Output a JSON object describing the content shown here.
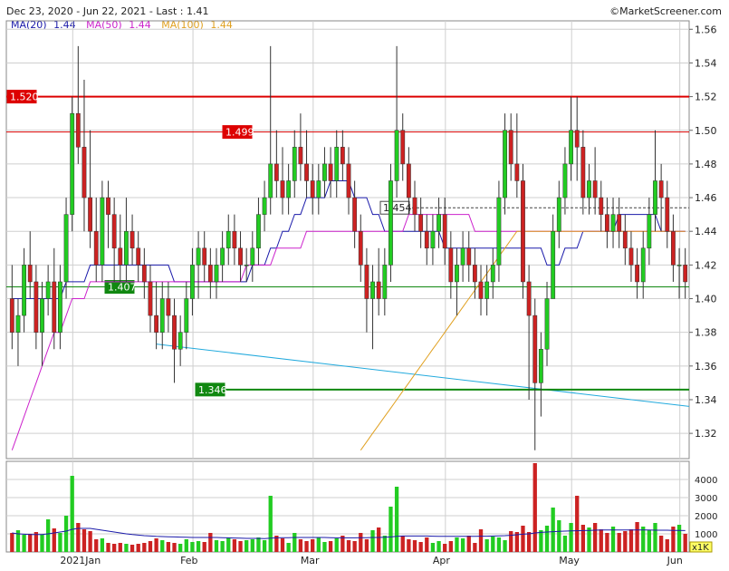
{
  "header": {
    "title": "Dec 23, 2020 - Jun 22, 2021 - Last : 1.41",
    "copyright": "©MarketScreener.com"
  },
  "legend": [
    {
      "label": "MA(20)",
      "value": "1.44",
      "color": "#1a1aaa"
    },
    {
      "label": "MA(50)",
      "value": "1.44",
      "color": "#cc22cc"
    },
    {
      "label": "MA(100)",
      "value": "1.44",
      "color": "#e0a020"
    }
  ],
  "colors": {
    "up": "#22cc22",
    "down": "#cc2222",
    "ma20": "#1a1aaa",
    "ma50": "#cc22cc",
    "ma100": "#e0a020",
    "trend": "#22aadd",
    "grid": "#cfcfcf"
  },
  "chart_data": [
    {
      "type": "candlestick",
      "y_axis_ticks": [
        "1.56",
        "1.54",
        "1.52",
        "1.50",
        "1.48",
        "1.46",
        "1.44",
        "1.42",
        "1.40",
        "1.38",
        "1.36",
        "1.34",
        "1.32"
      ],
      "ylim": [
        1.305,
        1.565
      ],
      "x_axis_labels": [
        "2021Jan",
        "Feb",
        "Mar",
        "Apr",
        "May",
        "Jun"
      ],
      "levels": [
        {
          "label": "1.520",
          "value": 1.52,
          "color": "#dd0000",
          "style": "solid-thick"
        },
        {
          "label": "1.499",
          "value": 1.499,
          "color": "#dd0000",
          "style": "solid"
        },
        {
          "label": "1.454",
          "value": 1.454,
          "color": "#444444",
          "style": "dashed"
        },
        {
          "label": "1.407",
          "value": 1.407,
          "color": "#118811",
          "style": "solid"
        },
        {
          "label": "1.346",
          "value": 1.346,
          "color": "#118811",
          "style": "solid-thick"
        }
      ],
      "trendline": {
        "from": [
          24,
          1.373
        ],
        "to": [
          124,
          1.336
        ]
      },
      "candles": [
        [
          1.4,
          1.42,
          1.37,
          1.38
        ],
        [
          1.38,
          1.4,
          1.36,
          1.39
        ],
        [
          1.39,
          1.43,
          1.38,
          1.42
        ],
        [
          1.42,
          1.44,
          1.4,
          1.41
        ],
        [
          1.41,
          1.42,
          1.37,
          1.38
        ],
        [
          1.38,
          1.41,
          1.36,
          1.4
        ],
        [
          1.4,
          1.42,
          1.39,
          1.41
        ],
        [
          1.41,
          1.43,
          1.37,
          1.38
        ],
        [
          1.38,
          1.42,
          1.37,
          1.41
        ],
        [
          1.41,
          1.46,
          1.4,
          1.45
        ],
        [
          1.45,
          1.52,
          1.44,
          1.51
        ],
        [
          1.51,
          1.55,
          1.48,
          1.49
        ],
        [
          1.49,
          1.53,
          1.44,
          1.46
        ],
        [
          1.46,
          1.5,
          1.43,
          1.44
        ],
        [
          1.44,
          1.46,
          1.41,
          1.42
        ],
        [
          1.42,
          1.47,
          1.41,
          1.46
        ],
        [
          1.46,
          1.47,
          1.43,
          1.45
        ],
        [
          1.45,
          1.46,
          1.41,
          1.43
        ],
        [
          1.43,
          1.45,
          1.41,
          1.42
        ],
        [
          1.42,
          1.46,
          1.41,
          1.44
        ],
        [
          1.44,
          1.45,
          1.42,
          1.43
        ],
        [
          1.43,
          1.44,
          1.41,
          1.42
        ],
        [
          1.42,
          1.43,
          1.4,
          1.41
        ],
        [
          1.41,
          1.42,
          1.38,
          1.39
        ],
        [
          1.39,
          1.41,
          1.37,
          1.38
        ],
        [
          1.38,
          1.41,
          1.37,
          1.4
        ],
        [
          1.4,
          1.41,
          1.38,
          1.39
        ],
        [
          1.39,
          1.4,
          1.35,
          1.37
        ],
        [
          1.37,
          1.39,
          1.36,
          1.38
        ],
        [
          1.38,
          1.41,
          1.37,
          1.4
        ],
        [
          1.4,
          1.43,
          1.39,
          1.42
        ],
        [
          1.42,
          1.44,
          1.4,
          1.43
        ],
        [
          1.43,
          1.44,
          1.41,
          1.42
        ],
        [
          1.42,
          1.43,
          1.4,
          1.41
        ],
        [
          1.41,
          1.43,
          1.4,
          1.42
        ],
        [
          1.42,
          1.44,
          1.41,
          1.43
        ],
        [
          1.43,
          1.45,
          1.42,
          1.44
        ],
        [
          1.44,
          1.45,
          1.42,
          1.43
        ],
        [
          1.43,
          1.44,
          1.41,
          1.42
        ],
        [
          1.42,
          1.43,
          1.41,
          1.42
        ],
        [
          1.42,
          1.44,
          1.41,
          1.43
        ],
        [
          1.43,
          1.46,
          1.42,
          1.45
        ],
        [
          1.45,
          1.47,
          1.44,
          1.46
        ],
        [
          1.46,
          1.55,
          1.45,
          1.48
        ],
        [
          1.48,
          1.5,
          1.46,
          1.47
        ],
        [
          1.47,
          1.49,
          1.45,
          1.46
        ],
        [
          1.46,
          1.48,
          1.45,
          1.47
        ],
        [
          1.47,
          1.5,
          1.46,
          1.49
        ],
        [
          1.49,
          1.51,
          1.47,
          1.48
        ],
        [
          1.48,
          1.5,
          1.46,
          1.47
        ],
        [
          1.47,
          1.48,
          1.45,
          1.46
        ],
        [
          1.46,
          1.48,
          1.45,
          1.47
        ],
        [
          1.47,
          1.49,
          1.46,
          1.48
        ],
        [
          1.48,
          1.49,
          1.46,
          1.47
        ],
        [
          1.47,
          1.5,
          1.46,
          1.49
        ],
        [
          1.49,
          1.5,
          1.47,
          1.48
        ],
        [
          1.48,
          1.49,
          1.45,
          1.46
        ],
        [
          1.46,
          1.47,
          1.43,
          1.44
        ],
        [
          1.44,
          1.45,
          1.41,
          1.42
        ],
        [
          1.42,
          1.43,
          1.38,
          1.4
        ],
        [
          1.4,
          1.42,
          1.37,
          1.41
        ],
        [
          1.41,
          1.43,
          1.39,
          1.4
        ],
        [
          1.4,
          1.43,
          1.39,
          1.42
        ],
        [
          1.42,
          1.48,
          1.41,
          1.47
        ],
        [
          1.47,
          1.55,
          1.46,
          1.5
        ],
        [
          1.5,
          1.51,
          1.47,
          1.48
        ],
        [
          1.48,
          1.49,
          1.45,
          1.46
        ],
        [
          1.46,
          1.47,
          1.44,
          1.45
        ],
        [
          1.45,
          1.46,
          1.43,
          1.44
        ],
        [
          1.44,
          1.45,
          1.42,
          1.43
        ],
        [
          1.43,
          1.45,
          1.42,
          1.44
        ],
        [
          1.44,
          1.46,
          1.43,
          1.45
        ],
        [
          1.45,
          1.46,
          1.42,
          1.43
        ],
        [
          1.43,
          1.44,
          1.4,
          1.41
        ],
        [
          1.41,
          1.43,
          1.39,
          1.42
        ],
        [
          1.42,
          1.44,
          1.41,
          1.43
        ],
        [
          1.43,
          1.44,
          1.41,
          1.42
        ],
        [
          1.42,
          1.43,
          1.4,
          1.41
        ],
        [
          1.41,
          1.42,
          1.39,
          1.4
        ],
        [
          1.4,
          1.42,
          1.39,
          1.41
        ],
        [
          1.41,
          1.43,
          1.4,
          1.42
        ],
        [
          1.42,
          1.47,
          1.41,
          1.46
        ],
        [
          1.46,
          1.51,
          1.45,
          1.5
        ],
        [
          1.5,
          1.51,
          1.47,
          1.48
        ],
        [
          1.48,
          1.51,
          1.46,
          1.47
        ],
        [
          1.47,
          1.48,
          1.4,
          1.41
        ],
        [
          1.41,
          1.42,
          1.34,
          1.39
        ],
        [
          1.39,
          1.4,
          1.31,
          1.35
        ],
        [
          1.35,
          1.38,
          1.33,
          1.37
        ],
        [
          1.37,
          1.41,
          1.36,
          1.4
        ],
        [
          1.4,
          1.45,
          1.4,
          1.44
        ],
        [
          1.44,
          1.47,
          1.43,
          1.46
        ],
        [
          1.46,
          1.49,
          1.45,
          1.48
        ],
        [
          1.48,
          1.52,
          1.47,
          1.5
        ],
        [
          1.5,
          1.52,
          1.47,
          1.49
        ],
        [
          1.49,
          1.5,
          1.45,
          1.46
        ],
        [
          1.46,
          1.48,
          1.45,
          1.47
        ],
        [
          1.47,
          1.49,
          1.45,
          1.46
        ],
        [
          1.46,
          1.47,
          1.44,
          1.45
        ],
        [
          1.45,
          1.46,
          1.43,
          1.44
        ],
        [
          1.44,
          1.46,
          1.43,
          1.45
        ],
        [
          1.45,
          1.46,
          1.43,
          1.44
        ],
        [
          1.44,
          1.45,
          1.42,
          1.43
        ],
        [
          1.43,
          1.44,
          1.41,
          1.42
        ],
        [
          1.42,
          1.43,
          1.4,
          1.41
        ],
        [
          1.41,
          1.44,
          1.4,
          1.43
        ],
        [
          1.43,
          1.46,
          1.42,
          1.45
        ],
        [
          1.45,
          1.5,
          1.44,
          1.47
        ],
        [
          1.47,
          1.48,
          1.44,
          1.46
        ],
        [
          1.46,
          1.47,
          1.43,
          1.44
        ],
        [
          1.44,
          1.45,
          1.41,
          1.42
        ],
        [
          1.42,
          1.43,
          1.4,
          1.42
        ],
        [
          1.42,
          1.43,
          1.4,
          1.41
        ]
      ],
      "ma20": [
        1.4,
        1.4,
        1.4,
        1.4,
        1.4,
        1.4,
        1.4,
        1.4,
        1.4,
        1.41,
        1.41,
        1.41,
        1.41,
        1.42,
        1.42,
        1.42,
        1.42,
        1.42,
        1.42,
        1.42,
        1.42,
        1.42,
        1.42,
        1.42,
        1.42,
        1.42,
        1.42,
        1.41,
        1.41,
        1.41,
        1.41,
        1.41,
        1.41,
        1.41,
        1.41,
        1.41,
        1.41,
        1.41,
        1.41,
        1.41,
        1.42,
        1.42,
        1.42,
        1.43,
        1.43,
        1.44,
        1.44,
        1.45,
        1.45,
        1.46,
        1.46,
        1.46,
        1.46,
        1.47,
        1.47,
        1.47,
        1.47,
        1.46,
        1.46,
        1.46,
        1.45,
        1.45,
        1.44,
        1.44,
        1.44,
        1.44,
        1.44,
        1.44,
        1.44,
        1.44,
        1.44,
        1.44,
        1.43,
        1.43,
        1.43,
        1.43,
        1.43,
        1.43,
        1.43,
        1.43,
        1.43,
        1.43,
        1.43,
        1.43,
        1.43,
        1.43,
        1.43,
        1.43,
        1.43,
        1.42,
        1.42,
        1.42,
        1.43,
        1.43,
        1.43,
        1.44,
        1.44,
        1.44,
        1.44,
        1.44,
        1.44,
        1.45,
        1.45,
        1.45,
        1.45,
        1.45,
        1.45,
        1.45,
        1.44,
        1.44,
        1.44,
        1.44,
        1.44
      ],
      "ma50": [
        1.31,
        1.32,
        1.33,
        1.34,
        1.35,
        1.36,
        1.37,
        1.38,
        1.38,
        1.39,
        1.4,
        1.4,
        1.4,
        1.41,
        1.41,
        1.41,
        1.41,
        1.41,
        1.41,
        1.41,
        1.41,
        1.41,
        1.41,
        1.41,
        1.41,
        1.41,
        1.41,
        1.41,
        1.41,
        1.41,
        1.41,
        1.41,
        1.41,
        1.41,
        1.41,
        1.41,
        1.41,
        1.41,
        1.41,
        1.42,
        1.42,
        1.42,
        1.42,
        1.42,
        1.43,
        1.43,
        1.43,
        1.43,
        1.43,
        1.44,
        1.44,
        1.44,
        1.44,
        1.44,
        1.44,
        1.44,
        1.44,
        1.44,
        1.44,
        1.44,
        1.44,
        1.44,
        1.44,
        1.44,
        1.44,
        1.44,
        1.45,
        1.45,
        1.45,
        1.45,
        1.45,
        1.45,
        1.45,
        1.45,
        1.45,
        1.45,
        1.45,
        1.44,
        1.44,
        1.44,
        1.44,
        1.44,
        1.44,
        1.44,
        1.44,
        1.44,
        1.44,
        1.44,
        1.44,
        1.44,
        1.44,
        1.44,
        1.44,
        1.44,
        1.44,
        1.44,
        1.44,
        1.44,
        1.44,
        1.44,
        1.44,
        1.44,
        1.44,
        1.44,
        1.44,
        1.44,
        1.44,
        1.44,
        1.44,
        1.44,
        1.44,
        1.44,
        1.44
      ],
      "ma100": [
        1.31,
        1.315,
        1.32,
        1.325,
        1.33,
        1.335,
        1.34,
        1.345,
        1.35,
        1.355,
        1.36,
        1.365,
        1.37,
        1.375,
        1.38,
        1.385,
        1.39,
        1.395,
        1.4,
        1.405,
        1.41,
        1.415,
        1.42,
        1.425,
        1.43,
        1.435,
        1.44,
        1.44,
        1.44,
        1.44,
        1.44,
        1.44,
        1.44,
        1.44,
        1.44,
        1.44,
        1.44,
        1.44,
        1.44,
        1.44,
        1.44,
        1.44,
        1.44,
        1.44,
        1.44,
        1.44,
        1.44,
        1.44,
        1.44,
        1.44,
        1.44,
        1.44,
        1.44,
        1.44,
        1.44,
        1.44,
        1.44,
        1.44,
        1.44,
        1.44,
        1.44,
        1.44,
        1.44,
        1.44,
        1.44,
        1.44,
        1.44,
        1.44,
        1.44,
        1.44,
        1.44,
        1.44,
        1.44,
        1.44,
        1.44,
        1.44,
        1.44,
        1.44,
        1.44,
        1.44,
        1.44,
        1.44,
        1.44,
        1.44,
        1.44,
        1.44,
        1.44,
        1.44,
        1.44,
        1.44,
        1.44,
        1.44,
        1.44,
        1.44,
        1.44,
        1.44,
        1.44,
        1.44,
        1.44,
        1.44,
        1.44,
        1.44,
        1.44,
        1.44,
        1.44,
        1.44,
        1.44,
        1.44,
        1.44,
        1.44,
        1.44,
        1.44,
        1.44
      ],
      "ma100_start_index": 58
    },
    {
      "type": "bar",
      "title": "",
      "y_axis_ticks": [
        "4000",
        "3000",
        "2000",
        "1000"
      ],
      "ylim": [
        0,
        4900
      ],
      "unit": "x1K",
      "volumes": [
        1050,
        1200,
        950,
        1000,
        1100,
        950,
        1800,
        1300,
        1050,
        2000,
        4200,
        1600,
        1250,
        1150,
        700,
        750,
        500,
        450,
        500,
        450,
        400,
        450,
        500,
        600,
        750,
        650,
        550,
        500,
        450,
        700,
        550,
        600,
        550,
        1050,
        650,
        600,
        800,
        700,
        600,
        650,
        700,
        800,
        650,
        3100,
        900,
        750,
        500,
        1050,
        700,
        600,
        700,
        800,
        550,
        600,
        750,
        900,
        650,
        600,
        1050,
        700,
        1200,
        1350,
        900,
        2500,
        3600,
        900,
        700,
        650,
        550,
        800,
        500,
        600,
        450,
        600,
        800,
        750,
        900,
        500,
        1250,
        700,
        850,
        800,
        650,
        1150,
        1100,
        1450,
        1100,
        4900,
        1200,
        1450,
        2450,
        1750,
        900,
        1600,
        3100,
        1500,
        1350,
        1600,
        1250,
        1050,
        1400,
        1050,
        1150,
        1250,
        1650,
        1400,
        1200,
        1600,
        900,
        700,
        1400,
        1500,
        1000
      ],
      "vol_ma": [
        1050,
        1000,
        980,
        960,
        960,
        960,
        1000,
        1050,
        1100,
        1150,
        1250,
        1300,
        1300,
        1300,
        1250,
        1200,
        1150,
        1100,
        1050,
        1000,
        960,
        930,
        900,
        880,
        860,
        850,
        840,
        830,
        820,
        810,
        800,
        800,
        800,
        800,
        800,
        790,
        780,
        770,
        760,
        750,
        750,
        750,
        740,
        760,
        780,
        790,
        790,
        800,
        800,
        800,
        800,
        800,
        800,
        790,
        780,
        780,
        780,
        780,
        790,
        790,
        800,
        800,
        810,
        830,
        860,
        880,
        880,
        880,
        880,
        880,
        870,
        860,
        860,
        860,
        860,
        860,
        860,
        860,
        870,
        870,
        880,
        890,
        900,
        920,
        950,
        980,
        1000,
        1050,
        1080,
        1100,
        1120,
        1140,
        1150,
        1160,
        1170,
        1180,
        1190,
        1200,
        1210,
        1210,
        1210,
        1210,
        1210,
        1210,
        1210,
        1210,
        1210,
        1200,
        1200,
        1200,
        1190,
        1190,
        1180
      ],
      "x_axis_labels": [
        "2021Jan",
        "Feb",
        "Mar",
        "Apr",
        "May",
        "Jun"
      ]
    }
  ]
}
